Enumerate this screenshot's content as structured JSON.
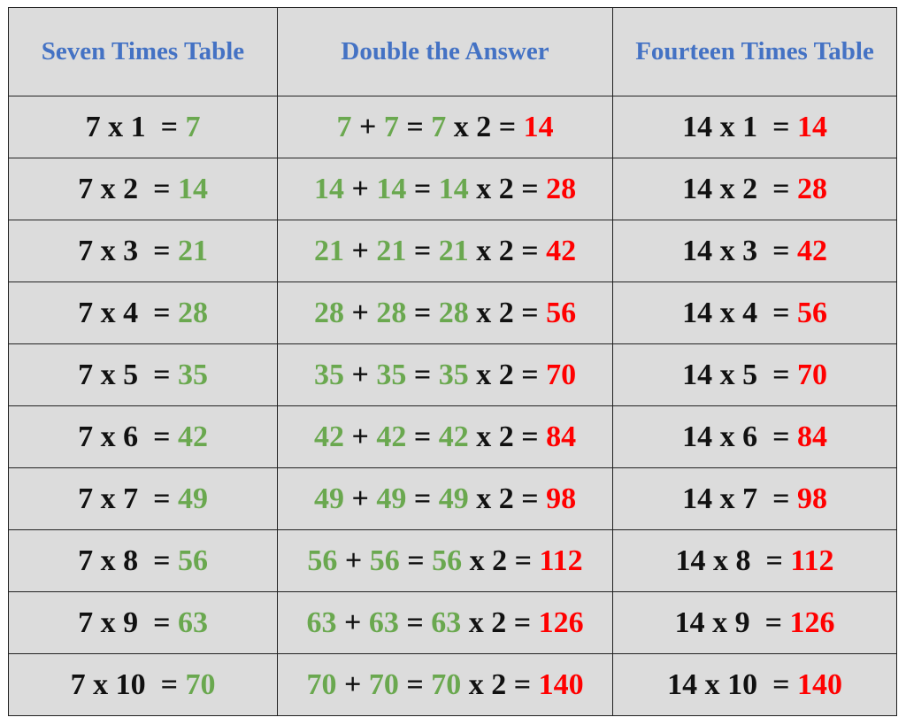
{
  "headers": [
    "Seven Times Table",
    "Double the Answer",
    "Fourteen Times Table"
  ],
  "colors": {
    "header": "#4472c4",
    "green": "#6aa84f",
    "red": "#ff0000",
    "background": "#dcdcdc"
  },
  "rows": [
    {
      "seven_eq": "7 x 1",
      "seven_ans": "7",
      "d_a": "7",
      "d_b": "7",
      "d_c": "7",
      "d_mult": "x 2",
      "d_res": "14",
      "f_eq": "14 x 1",
      "f_ans": "14"
    },
    {
      "seven_eq": "7 x 2",
      "seven_ans": "14",
      "d_a": "14",
      "d_b": "14",
      "d_c": "14",
      "d_mult": "x 2",
      "d_res": "28",
      "f_eq": "14 x 2",
      "f_ans": "28"
    },
    {
      "seven_eq": "7 x 3",
      "seven_ans": "21",
      "d_a": "21",
      "d_b": "21",
      "d_c": "21",
      "d_mult": "x 2",
      "d_res": "42",
      "f_eq": "14 x 3",
      "f_ans": "42"
    },
    {
      "seven_eq": "7 x 4",
      "seven_ans": "28",
      "d_a": "28",
      "d_b": "28",
      "d_c": "28",
      "d_mult": "x 2",
      "d_res": "56",
      "f_eq": "14 x 4",
      "f_ans": "56"
    },
    {
      "seven_eq": "7 x 5",
      "seven_ans": "35",
      "d_a": "35",
      "d_b": "35",
      "d_c": "35",
      "d_mult": "x 2",
      "d_res": "70",
      "f_eq": "14 x 5",
      "f_ans": "70"
    },
    {
      "seven_eq": "7 x 6",
      "seven_ans": "42",
      "d_a": "42",
      "d_b": "42",
      "d_c": "42",
      "d_mult": "x 2",
      "d_res": "84",
      "f_eq": "14 x 6",
      "f_ans": "84"
    },
    {
      "seven_eq": "7 x 7",
      "seven_ans": "49",
      "d_a": "49",
      "d_b": "49",
      "d_c": "49",
      "d_mult": "x 2",
      "d_res": "98",
      "f_eq": "14 x 7",
      "f_ans": "98"
    },
    {
      "seven_eq": "7 x 8",
      "seven_ans": "56",
      "d_a": "56",
      "d_b": "56",
      "d_c": "56",
      "d_mult": "x 2",
      "d_res": "112",
      "f_eq": "14 x 8",
      "f_ans": "112"
    },
    {
      "seven_eq": "7 x 9",
      "seven_ans": "63",
      "d_a": "63",
      "d_b": "63",
      "d_c": "63",
      "d_mult": "x 2",
      "d_res": "126",
      "f_eq": "14 x 9",
      "f_ans": "126"
    },
    {
      "seven_eq": "7 x 10",
      "seven_ans": "70",
      "d_a": "70",
      "d_b": "70",
      "d_c": "70",
      "d_mult": "x 2",
      "d_res": "140",
      "f_eq": "14 x 10",
      "f_ans": "140"
    }
  ]
}
